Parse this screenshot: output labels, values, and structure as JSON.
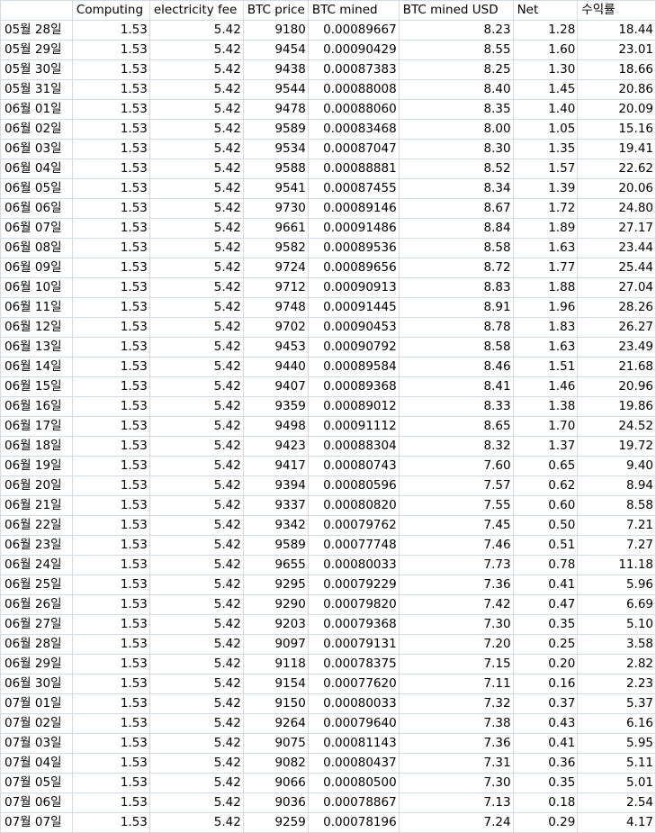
{
  "sheet": {
    "columns": [
      "",
      "Computing",
      "electricity fee",
      "BTC price",
      "BTC mined",
      "BTC mined USD",
      "Net",
      "수익률"
    ],
    "rows": [
      [
        "05월 28일",
        "1.53",
        "5.42",
        "9180",
        "0.00089667",
        "8.23",
        "1.28",
        "18.44"
      ],
      [
        "05월 29일",
        "1.53",
        "5.42",
        "9454",
        "0.00090429",
        "8.55",
        "1.60",
        "23.01"
      ],
      [
        "05월 30일",
        "1.53",
        "5.42",
        "9438",
        "0.00087383",
        "8.25",
        "1.30",
        "18.66"
      ],
      [
        "05월 31일",
        "1.53",
        "5.42",
        "9544",
        "0.00088008",
        "8.40",
        "1.45",
        "20.86"
      ],
      [
        "06월 01일",
        "1.53",
        "5.42",
        "9478",
        "0.00088060",
        "8.35",
        "1.40",
        "20.09"
      ],
      [
        "06월 02일",
        "1.53",
        "5.42",
        "9589",
        "0.00083468",
        "8.00",
        "1.05",
        "15.16"
      ],
      [
        "06월 03일",
        "1.53",
        "5.42",
        "9534",
        "0.00087047",
        "8.30",
        "1.35",
        "19.41"
      ],
      [
        "06월 04일",
        "1.53",
        "5.42",
        "9588",
        "0.00088881",
        "8.52",
        "1.57",
        "22.62"
      ],
      [
        "06월 05일",
        "1.53",
        "5.42",
        "9541",
        "0.00087455",
        "8.34",
        "1.39",
        "20.06"
      ],
      [
        "06월 06일",
        "1.53",
        "5.42",
        "9730",
        "0.00089146",
        "8.67",
        "1.72",
        "24.80"
      ],
      [
        "06월 07일",
        "1.53",
        "5.42",
        "9661",
        "0.00091486",
        "8.84",
        "1.89",
        "27.17"
      ],
      [
        "06월 08일",
        "1.53",
        "5.42",
        "9582",
        "0.00089536",
        "8.58",
        "1.63",
        "23.44"
      ],
      [
        "06월 09일",
        "1.53",
        "5.42",
        "9724",
        "0.00089656",
        "8.72",
        "1.77",
        "25.44"
      ],
      [
        "06월 10일",
        "1.53",
        "5.42",
        "9712",
        "0.00090913",
        "8.83",
        "1.88",
        "27.04"
      ],
      [
        "06월 11일",
        "1.53",
        "5.42",
        "9748",
        "0.00091445",
        "8.91",
        "1.96",
        "28.26"
      ],
      [
        "06월 12일",
        "1.53",
        "5.42",
        "9702",
        "0.00090453",
        "8.78",
        "1.83",
        "26.27"
      ],
      [
        "06월 13일",
        "1.53",
        "5.42",
        "9453",
        "0.00090792",
        "8.58",
        "1.63",
        "23.49"
      ],
      [
        "06월 14일",
        "1.53",
        "5.42",
        "9440",
        "0.00089584",
        "8.46",
        "1.51",
        "21.68"
      ],
      [
        "06월 15일",
        "1.53",
        "5.42",
        "9407",
        "0.00089368",
        "8.41",
        "1.46",
        "20.96"
      ],
      [
        "06월 16일",
        "1.53",
        "5.42",
        "9359",
        "0.00089012",
        "8.33",
        "1.38",
        "19.86"
      ],
      [
        "06월 17일",
        "1.53",
        "5.42",
        "9498",
        "0.00091112",
        "8.65",
        "1.70",
        "24.52"
      ],
      [
        "06월 18일",
        "1.53",
        "5.42",
        "9423",
        "0.00088304",
        "8.32",
        "1.37",
        "19.72"
      ],
      [
        "06월 19일",
        "1.53",
        "5.42",
        "9417",
        "0.00080743",
        "7.60",
        "0.65",
        "9.40"
      ],
      [
        "06월 20일",
        "1.53",
        "5.42",
        "9394",
        "0.00080596",
        "7.57",
        "0.62",
        "8.94"
      ],
      [
        "06월 21일",
        "1.53",
        "5.42",
        "9337",
        "0.00080820",
        "7.55",
        "0.60",
        "8.58"
      ],
      [
        "06월 22일",
        "1.53",
        "5.42",
        "9342",
        "0.00079762",
        "7.45",
        "0.50",
        "7.21"
      ],
      [
        "06월 23일",
        "1.53",
        "5.42",
        "9589",
        "0.00077748",
        "7.46",
        "0.51",
        "7.27"
      ],
      [
        "06월 24일",
        "1.53",
        "5.42",
        "9655",
        "0.00080033",
        "7.73",
        "0.78",
        "11.18"
      ],
      [
        "06월 25일",
        "1.53",
        "5.42",
        "9295",
        "0.00079229",
        "7.36",
        "0.41",
        "5.96"
      ],
      [
        "06월 26일",
        "1.53",
        "5.42",
        "9290",
        "0.00079820",
        "7.42",
        "0.47",
        "6.69"
      ],
      [
        "06월 27일",
        "1.53",
        "5.42",
        "9203",
        "0.00079368",
        "7.30",
        "0.35",
        "5.10"
      ],
      [
        "06월 28일",
        "1.53",
        "5.42",
        "9097",
        "0.00079131",
        "7.20",
        "0.25",
        "3.58"
      ],
      [
        "06월 29일",
        "1.53",
        "5.42",
        "9118",
        "0.00078375",
        "7.15",
        "0.20",
        "2.82"
      ],
      [
        "06월 30일",
        "1.53",
        "5.42",
        "9154",
        "0.00077620",
        "7.11",
        "0.16",
        "2.23"
      ],
      [
        "07월 01일",
        "1.53",
        "5.42",
        "9150",
        "0.00080033",
        "7.32",
        "0.37",
        "5.37"
      ],
      [
        "07월 02일",
        "1.53",
        "5.42",
        "9264",
        "0.00079640",
        "7.38",
        "0.43",
        "6.16"
      ],
      [
        "07월 03일",
        "1.53",
        "5.42",
        "9075",
        "0.00081143",
        "7.36",
        "0.41",
        "5.95"
      ],
      [
        "07월 04일",
        "1.53",
        "5.42",
        "9082",
        "0.00080437",
        "7.31",
        "0.36",
        "5.11"
      ],
      [
        "07월 05일",
        "1.53",
        "5.42",
        "9066",
        "0.00080500",
        "7.30",
        "0.35",
        "5.01"
      ],
      [
        "07월 06일",
        "1.53",
        "5.42",
        "9036",
        "0.00078867",
        "7.13",
        "0.18",
        "2.54"
      ],
      [
        "07월 07일",
        "1.53",
        "5.42",
        "9259",
        "0.00078196",
        "7.24",
        "0.29",
        "4.17"
      ]
    ]
  }
}
